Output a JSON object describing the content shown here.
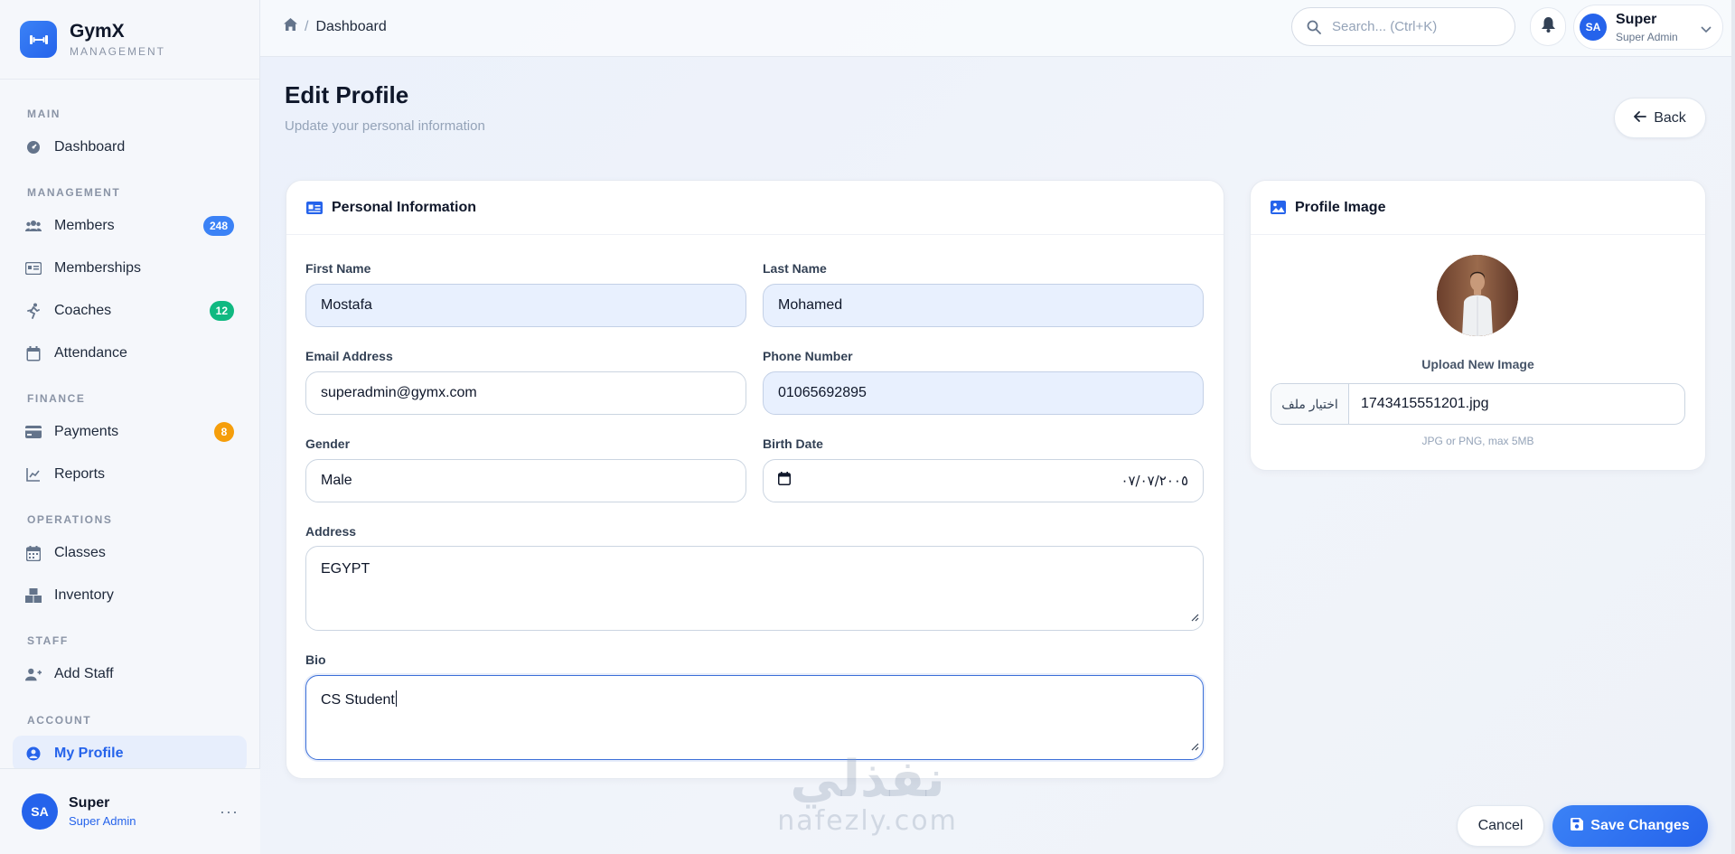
{
  "brand": {
    "name": "GymX",
    "subtitle": "MANAGEMENT"
  },
  "sidebar": {
    "sections": [
      {
        "title": "MAIN"
      },
      {
        "title": "MANAGEMENT"
      },
      {
        "title": "FINANCE"
      },
      {
        "title": "OPERATIONS"
      },
      {
        "title": "STAFF"
      },
      {
        "title": "ACCOUNT"
      }
    ],
    "items": [
      {
        "label": "Dashboard",
        "icon": "gauge-icon"
      },
      {
        "label": "Members",
        "icon": "users-icon",
        "badge": "248",
        "badge_color": "#3b82f6"
      },
      {
        "label": "Memberships",
        "icon": "id-card-icon"
      },
      {
        "label": "Coaches",
        "icon": "running-icon",
        "badge": "12",
        "badge_color": "#10b981"
      },
      {
        "label": "Attendance",
        "icon": "calendar-check-icon"
      },
      {
        "label": "Payments",
        "icon": "credit-card-icon",
        "badge": "8",
        "badge_color": "#f59e0b"
      },
      {
        "label": "Reports",
        "icon": "chart-line-icon"
      },
      {
        "label": "Classes",
        "icon": "calendar-icon"
      },
      {
        "label": "Inventory",
        "icon": "boxes-icon"
      },
      {
        "label": "Add Staff",
        "icon": "user-plus-icon"
      },
      {
        "label": "My Profile",
        "icon": "user-circle-icon",
        "active": true
      }
    ],
    "user": {
      "initials": "SA",
      "name": "Super",
      "role": "Super Admin"
    }
  },
  "topbar": {
    "breadcrumb": "Dashboard",
    "search_placeholder": "Search... (Ctrl+K)",
    "user": {
      "initials": "SA",
      "name": "Super",
      "role": "Super Admin"
    }
  },
  "header": {
    "title": "Edit Profile",
    "subtitle": "Update your personal information",
    "back_label": "Back"
  },
  "personal": {
    "title": "Personal Information",
    "first_name": {
      "label": "First Name",
      "value": "Mostafa"
    },
    "last_name": {
      "label": "Last Name",
      "value": "Mohamed"
    },
    "email": {
      "label": "Email Address",
      "value": "superadmin@gymx.com"
    },
    "phone": {
      "label": "Phone Number",
      "value": "01065692895"
    },
    "gender": {
      "label": "Gender",
      "value": "Male"
    },
    "birth_date": {
      "label": "Birth Date",
      "value": "٠٧/٠٧/٢٠٠٥"
    },
    "address": {
      "label": "Address",
      "value": "EGYPT"
    },
    "bio": {
      "label": "Bio",
      "value": "CS Student"
    }
  },
  "profile_image": {
    "title": "Profile Image",
    "upload_label": "Upload New Image",
    "file_button": "اختيار ملف",
    "file_name": "1743415551201.jpg",
    "hint": "JPG or PNG, max 5MB"
  },
  "actions": {
    "cancel": "Cancel",
    "save": "Save Changes"
  },
  "watermark": {
    "arabic": "نفذلي",
    "latin": "nafezly.com"
  },
  "colors": {
    "primary": "#2563eb",
    "accent": "#3b82f6",
    "filled_input": "#e8f0fe"
  }
}
